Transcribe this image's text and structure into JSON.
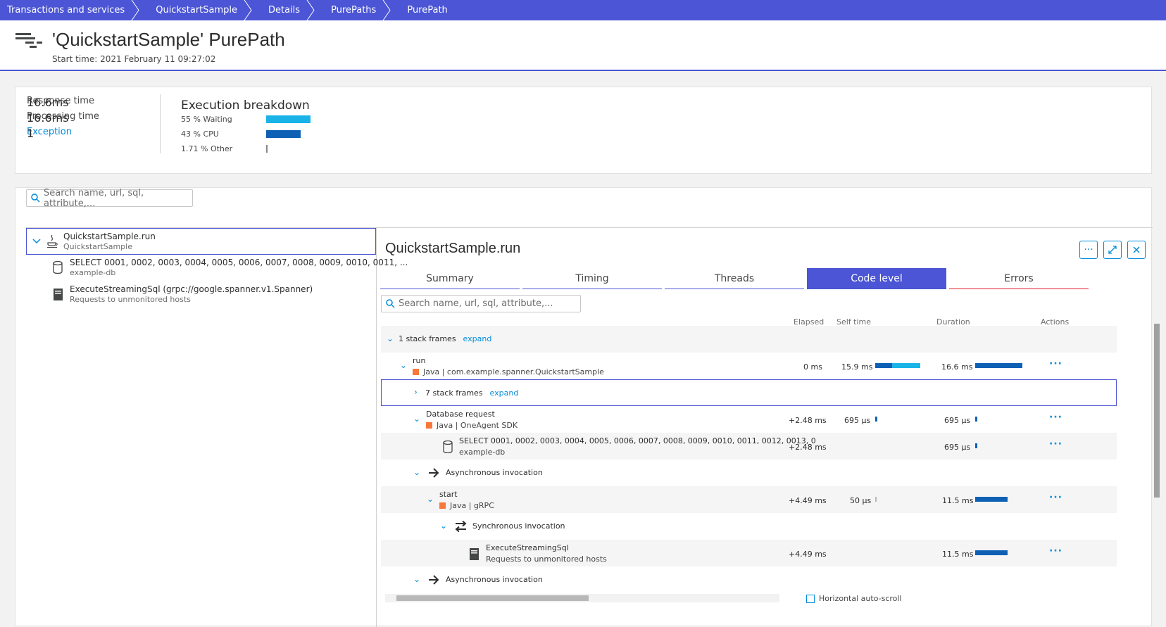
{
  "breadcrumbs": [
    "Transactions and services",
    "QuickstartSample",
    "Details",
    "PurePaths",
    "PurePath"
  ],
  "header": {
    "title": "'QuickstartSample' PurePath",
    "start_time": "Start time: 2021 February 11 09:27:02"
  },
  "summary": {
    "response_time_value": "16.6ms",
    "response_time_label": "Response time",
    "processing_time_value": "16.6ms",
    "processing_time_label": "Processing time",
    "exception_count": "1",
    "exception_label": "Exception",
    "breakdown_title": "Execution breakdown",
    "breakdown": [
      {
        "label": "55 % Waiting",
        "percent": 55,
        "color": "#1ab3e8"
      },
      {
        "label": "43 % CPU",
        "percent": 43,
        "color": "#0e60b5"
      },
      {
        "label": "1.71 % Other",
        "percent": 1.71,
        "color": "#888888"
      }
    ]
  },
  "left_search_placeholder": "Search name, url, sql, attribute,...",
  "tree": [
    {
      "name": "QuickstartSample.run",
      "sub": "QuickstartSample",
      "icon": "java-icon"
    },
    {
      "name": "SELECT 0001, 0002, 0003, 0004, 0005, 0006, 0007, 0008, 0009, 0010, 0011, ...",
      "sub": "example-db",
      "icon": "database-icon"
    },
    {
      "name": "ExecuteStreamingSql (grpc://google.spanner.v1.Spanner)",
      "sub": "Requests to unmonitored hosts",
      "icon": "server-icon"
    }
  ],
  "detail": {
    "title": "QuickstartSample.run",
    "tabs": [
      "Summary",
      "Timing",
      "Threads",
      "Code level",
      "Errors"
    ],
    "search_placeholder": "Search name, url, sql, attribute,...",
    "columns": {
      "elapsed": "Elapsed",
      "self_time": "Self time",
      "duration": "Duration",
      "actions": "Actions"
    },
    "expand_label": "expand",
    "rows": [
      {
        "kind": "frames",
        "label": "1 stack frames"
      },
      {
        "kind": "method",
        "name": "run",
        "tech": "Java | com.example.spanner.QuickstartSample",
        "elapsed": "0 ms",
        "self": "15.9 ms",
        "duration": "16.6 ms",
        "self_cpu": 0.38,
        "self_wait": 0.62,
        "duration_frac": 1.0
      },
      {
        "kind": "frames",
        "label": "7 stack frames"
      },
      {
        "kind": "method",
        "name": "Database request",
        "tech": "Java | OneAgent SDK",
        "elapsed": "+2.48 ms",
        "self": "695 µs",
        "duration": "695 µs",
        "self_frac": 0.04,
        "duration_frac": 0.04
      },
      {
        "kind": "sql",
        "name": "SELECT 0001, 0002, 0003, 0004, 0005, 0006, 0007, 0008, 0009, 0010, 0011, 0012, 0013, 0",
        "sub": "example-db",
        "elapsed": "+2.48 ms",
        "duration": "695 µs",
        "duration_frac": 0.04
      },
      {
        "kind": "invoke",
        "label": "Asynchronous invocation"
      },
      {
        "kind": "method",
        "name": "start",
        "tech": "Java | gRPC",
        "elapsed": "+4.49 ms",
        "self": "50 µs",
        "duration": "11.5 ms",
        "self_frac": 0.01,
        "duration_frac": 0.69
      },
      {
        "kind": "sync",
        "label": "Synchronous invocation"
      },
      {
        "kind": "call",
        "name": "ExecuteStreamingSql",
        "sub": "Requests to unmonitored hosts",
        "elapsed": "+4.49 ms",
        "duration": "11.5 ms",
        "duration_frac": 0.69
      },
      {
        "kind": "invoke",
        "label": "Asynchronous invocation"
      }
    ],
    "autoscroll_label": "Horizontal auto-scroll"
  }
}
